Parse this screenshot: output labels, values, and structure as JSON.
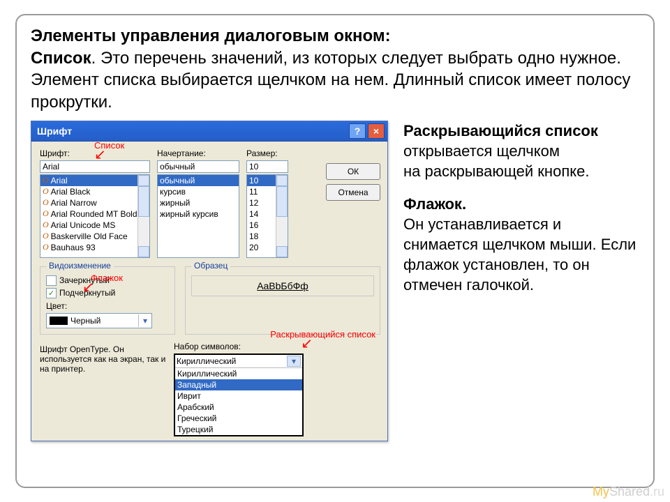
{
  "heading": {
    "l1_strong": "Элементы управления диалоговым окном:",
    "l2_strong": "Список",
    "l2_rest": ". Это перечень значений, из которых следует выбрать одно нужное. Элемент списка выбирается щелчком на нем. Длинный список имеет полосу прокрутки."
  },
  "dialog": {
    "title": "Шрифт",
    "help": "?",
    "close": "×",
    "labels": {
      "font": "Шрифт:",
      "style": "Начертание:",
      "size": "Размер:"
    },
    "font_value": "Arial",
    "font_list": [
      "Arial",
      "Arial Black",
      "Arial Narrow",
      "Arial Rounded MT Bold",
      "Arial Unicode MS",
      "Baskerville Old Face",
      "Bauhaus 93"
    ],
    "font_selected": "Arial",
    "style_value": "обычный",
    "style_list": [
      "обычный",
      "курсив",
      "жирный",
      "жирный курсив"
    ],
    "style_selected": "обычный",
    "size_value": "10",
    "size_list": [
      "10",
      "11",
      "12",
      "14",
      "16",
      "18",
      "20"
    ],
    "size_selected": "10",
    "buttons": {
      "ok": "ОК",
      "cancel": "Отмена"
    },
    "effects": {
      "legend": "Видоизменение",
      "strike": "Зачеркнутый",
      "underline": "Подчеркнутый",
      "underline_checked": "✓",
      "color_label": "Цвет:",
      "color_value": "Черный"
    },
    "sample": {
      "legend": "Образец",
      "text": "AaBbБбФф"
    },
    "charset": {
      "label": "Набор символов:",
      "value": "Кириллический",
      "options": [
        "Кириллический",
        "Западный",
        "Иврит",
        "Арабский",
        "Греческий",
        "Турецкий"
      ],
      "selected": "Западный"
    },
    "info": "Шрифт OpenType. Он используется как на экран, так и на принтер."
  },
  "annotations": {
    "list": "Список",
    "checkbox": "Флажок",
    "dropdown": "Раскрывающийся список"
  },
  "right": {
    "p1a_b": "Раскрывающийся список",
    "p1a": " открывается щелчком",
    "p1b": " на раскрывающей кнопке.",
    "p2_b": "Флажок.",
    "p2": "Он устанавливается и снимается щелчком мыши. Если флажок установлен, то он отмечен галочкой."
  },
  "watermark": {
    "a": "My",
    "b": "Shared",
    "c": ".ru"
  }
}
